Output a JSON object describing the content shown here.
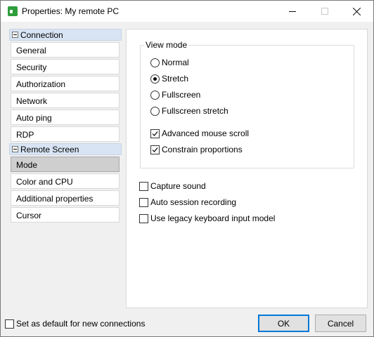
{
  "window": {
    "title": "Properties: My remote PC"
  },
  "nav": {
    "groups": [
      {
        "label": "Connection",
        "items": [
          "General",
          "Security",
          "Authorization",
          "Network",
          "Auto ping",
          "RDP"
        ]
      },
      {
        "label": "Remote Screen",
        "items": [
          "Mode",
          "Color and CPU",
          "Additional properties",
          "Cursor"
        ]
      }
    ],
    "selected": "Mode"
  },
  "view_mode": {
    "title": "View mode",
    "options": [
      "Normal",
      "Stretch",
      "Fullscreen",
      "Fullscreen stretch"
    ],
    "selected": "Stretch",
    "advanced_mouse_scroll": {
      "label": "Advanced mouse scroll",
      "checked": true
    },
    "constrain_proportions": {
      "label": "Constrain proportions",
      "checked": true
    }
  },
  "options": {
    "capture_sound": {
      "label": "Capture sound",
      "checked": false
    },
    "auto_session_recording": {
      "label": "Auto session recording",
      "checked": false
    },
    "legacy_keyboard": {
      "label": "Use legacy keyboard input model",
      "checked": false
    }
  },
  "footer": {
    "default_checkbox": {
      "label": "Set as default for new connections",
      "checked": false
    },
    "ok_label": "OK",
    "cancel_label": "Cancel"
  }
}
